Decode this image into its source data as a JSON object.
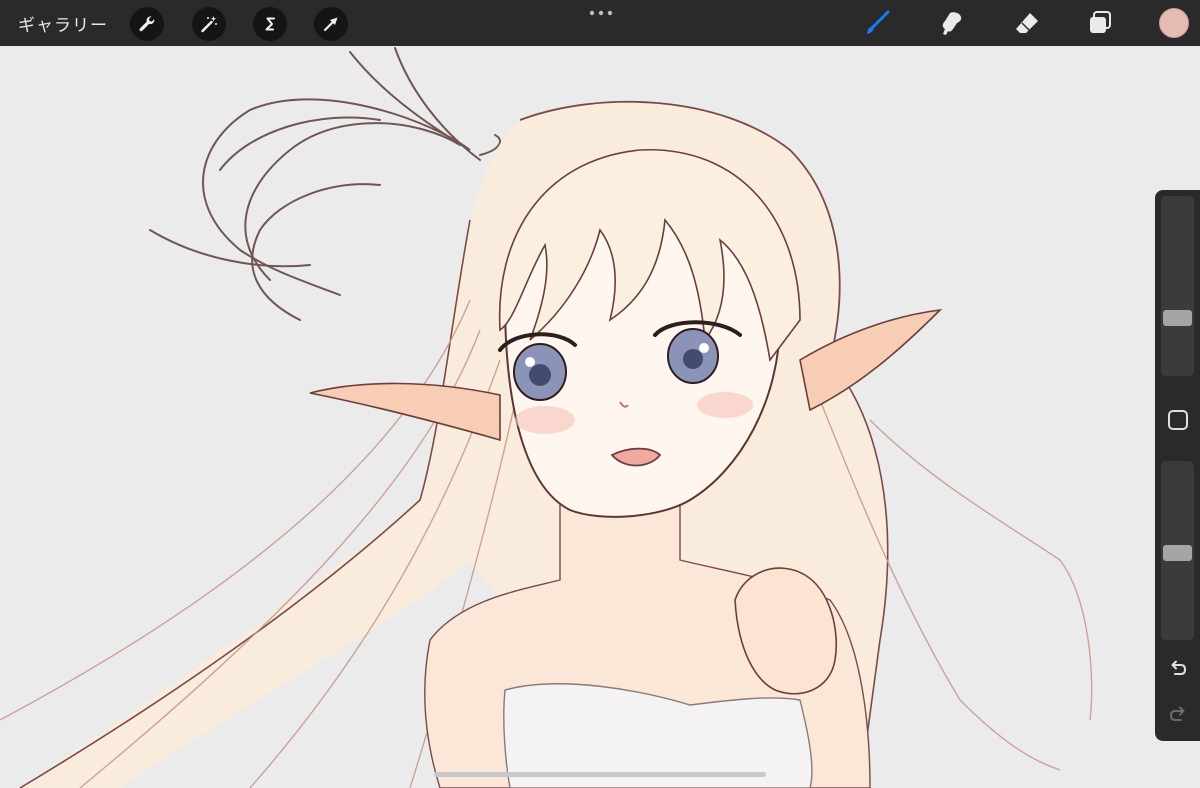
{
  "toolbar": {
    "gallery_label": "ギャラリー",
    "left_tools": [
      {
        "name": "actions",
        "icon": "wrench-icon"
      },
      {
        "name": "adjustments",
        "icon": "magic-wand-icon"
      },
      {
        "name": "selection",
        "icon": "selection-s-icon"
      },
      {
        "name": "transform",
        "icon": "arrow-cursor-icon"
      }
    ],
    "more_icon": "ellipsis-icon",
    "right_tools": [
      {
        "name": "brush",
        "icon": "brush-icon",
        "active": true
      },
      {
        "name": "smudge",
        "icon": "smudge-icon"
      },
      {
        "name": "eraser",
        "icon": "eraser-icon"
      },
      {
        "name": "layers",
        "icon": "layers-icon"
      }
    ],
    "current_color": "#e6bbb3",
    "active_tool_color": "#1a7cf5"
  },
  "sidebar": {
    "brush_size_level": 0.35,
    "opacity_level": 0.5,
    "modify_icon": "square-modify-icon",
    "undo_icon": "undo-icon",
    "redo_icon": "redo-icon"
  },
  "canvas": {
    "background": "#ebebeb",
    "subject": "illustration-elf-girl"
  }
}
